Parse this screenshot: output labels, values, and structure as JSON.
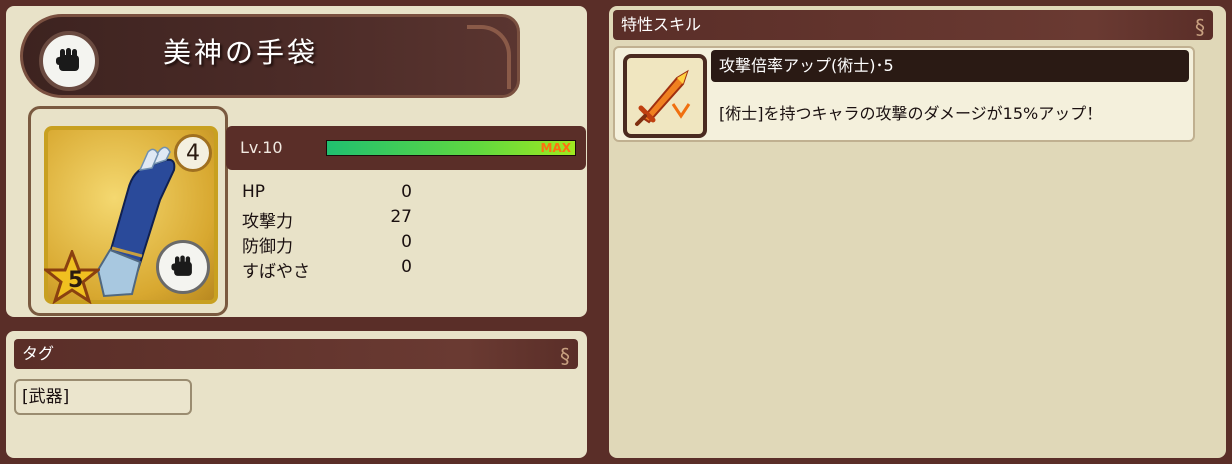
{
  "item": {
    "name": "美神の手袋",
    "title_icon": "fist-icon",
    "level_badge": "4",
    "rarity": "5",
    "level_label": "Lv.10",
    "exp_fraction": 1.0,
    "exp_max_label": "MAX",
    "stats": [
      {
        "name": "HP",
        "value": "0"
      },
      {
        "name": "攻撃力",
        "value": "27"
      },
      {
        "name": "防御力",
        "value": "0"
      },
      {
        "name": "すばやさ",
        "value": "0"
      }
    ]
  },
  "tags": {
    "header": "タグ",
    "items": [
      "[武器]"
    ]
  },
  "skills": {
    "header": "特性スキル",
    "entries": [
      {
        "icon": "flaming-sword-icon",
        "name": "攻撃倍率アップ(術士)･5",
        "description": "[術士]を持つキャラの攻撃のダメージが15%アップ！"
      }
    ]
  },
  "colors": {
    "background": "#5a2e28",
    "panel": "#e8e2c8",
    "exp_bar_start": "#20c070",
    "exp_bar_end": "#a0e820",
    "max_label": "#ff7010",
    "card_gold": "#d8a830"
  }
}
